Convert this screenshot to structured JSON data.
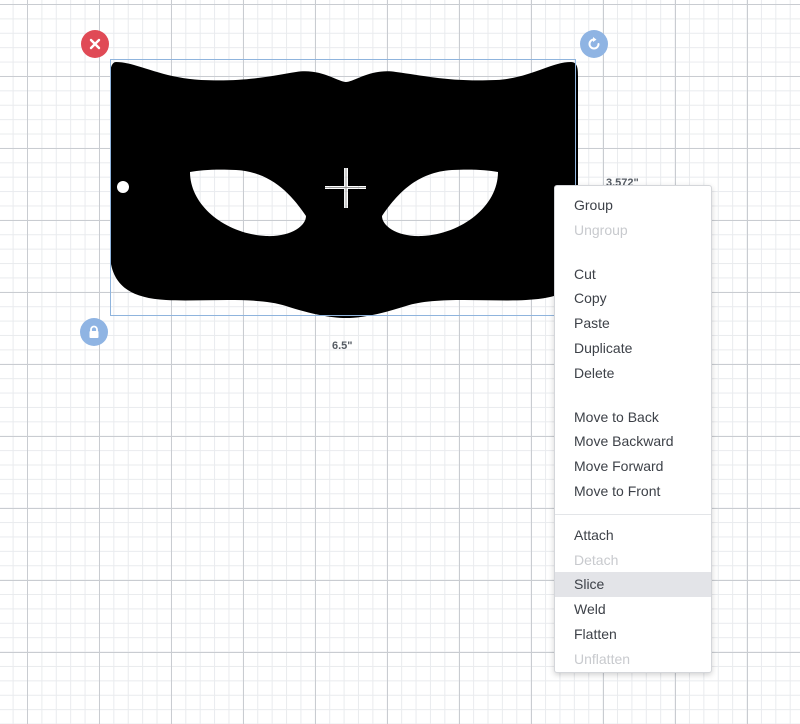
{
  "canvas": {
    "selection": {
      "width_label": "6.5\"",
      "height_label": "3.572\""
    },
    "handles": {
      "delete_icon": "close-icon",
      "rotate_icon": "rotate-icon",
      "lock_icon": "lock-icon"
    },
    "colors": {
      "delete": "#e04a56",
      "handle": "#8fb4e3",
      "selection_border": "#8fb4dd",
      "shape": "#000000"
    }
  },
  "context_menu": {
    "group": "Group",
    "ungroup": "Ungroup",
    "cut": "Cut",
    "copy": "Copy",
    "paste": "Paste",
    "duplicate": "Duplicate",
    "delete": "Delete",
    "move_to_back": "Move to Back",
    "move_backward": "Move Backward",
    "move_forward": "Move Forward",
    "move_to_front": "Move to Front",
    "attach": "Attach",
    "detach": "Detach",
    "slice": "Slice",
    "weld": "Weld",
    "flatten": "Flatten",
    "unflatten": "Unflatten",
    "highlighted": "Slice"
  }
}
